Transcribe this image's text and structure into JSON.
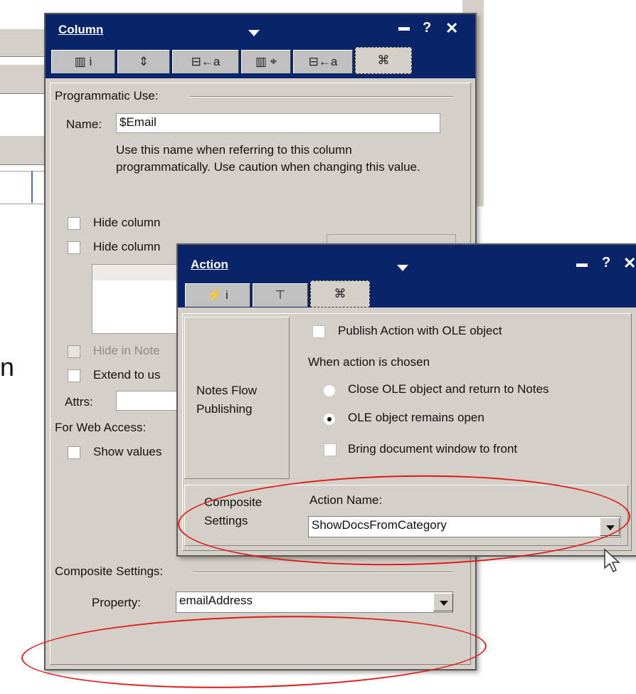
{
  "column_panel": {
    "title": "Column",
    "tabs": [
      "▥ i",
      "⇕",
      "⊟←a",
      "▥ ⌖",
      "⊟←a",
      "⌘"
    ],
    "programmatic_use": {
      "legend": "Programmatic Use:",
      "name_label": "Name:",
      "name_value": "$Email",
      "note": "Use this name when referring to this column programmatically.  Use caution when changing this value."
    },
    "hide_column": "Hide column",
    "hide_column_if": "Hide column",
    "hide_in_notes": "Hide in Note",
    "extend_to_use": "Extend to us",
    "attrs_label": "Attrs:",
    "web_access_legend": "For Web Access:",
    "show_values": "Show values",
    "composite": {
      "legend": "Composite Settings:",
      "property_label": "Property:",
      "property_value": "emailAddress"
    }
  },
  "action_panel": {
    "title": "Action",
    "tabs": [
      "⚡ i",
      "⊤",
      "⌘"
    ],
    "section_notes_flow": "Notes Flow Publishing",
    "publish_checkbox": "Publish Action with OLE object",
    "when_chosen": "When action is chosen",
    "radio_close": "Close OLE object and return to Notes",
    "radio_open": "OLE object remains open",
    "bring_front": "Bring document window to front",
    "section_composite": "Composite Settings",
    "action_name_label": "Action Name:",
    "action_name_value": "ShowDocsFromCategory"
  },
  "colors": {
    "titlebar": "#0a246a",
    "panel": "#d4d0c8",
    "highlight": "#e01818"
  }
}
